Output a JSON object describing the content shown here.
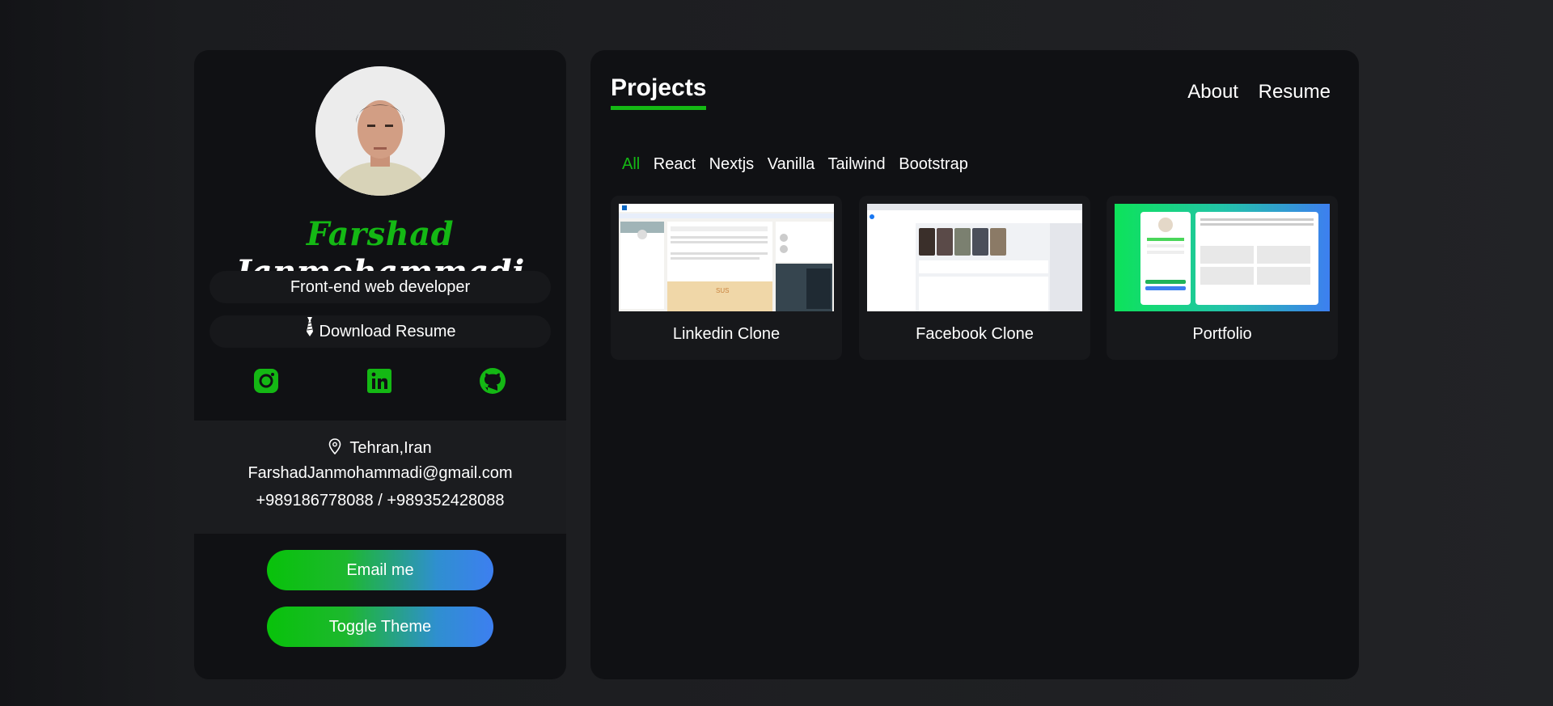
{
  "profile": {
    "first_name": "Farshad",
    "last_name": "Janmohammadi",
    "role": "Front-end web developer",
    "download_label": "Download Resume",
    "location": "Tehran,Iran",
    "email": "FarshadJanmohammadi@gmail.com",
    "phone": "+989186778088 / +989352428088",
    "email_button": "Email me",
    "theme_button": "Toggle Theme",
    "socials": [
      "instagram-icon",
      "linkedin-icon",
      "github-icon"
    ]
  },
  "main": {
    "title": "Projects",
    "nav": [
      "About",
      "Resume"
    ],
    "filters": [
      "All",
      "React",
      "Nextjs",
      "Vanilla",
      "Tailwind",
      "Bootstrap"
    ],
    "active_filter": "All",
    "projects": [
      {
        "label": "Linkedin Clone"
      },
      {
        "label": "Facebook Clone"
      },
      {
        "label": "Portfolio"
      }
    ]
  },
  "colors": {
    "accent": "#14b814",
    "panel": "#101114",
    "gradient_start": "#08c20a",
    "gradient_end": "#3d7ff0"
  }
}
